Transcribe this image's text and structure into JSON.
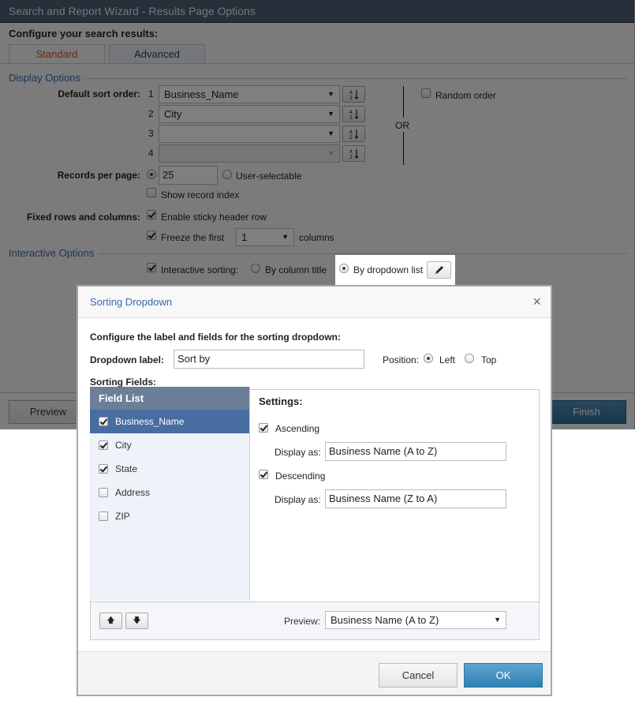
{
  "window": {
    "title": "Search and Report Wizard - Results Page Options"
  },
  "heading": "Configure your search results:",
  "tabs": [
    {
      "label": "Standard",
      "active": true
    },
    {
      "label": "Advanced",
      "active": false
    }
  ],
  "display_options": {
    "section_title": "Display Options",
    "sort_order_label": "Default sort order:",
    "sort_rows": [
      {
        "num": "1",
        "value": "Business_Name",
        "disabled": false
      },
      {
        "num": "2",
        "value": "City",
        "disabled": false
      },
      {
        "num": "3",
        "value": "",
        "disabled": false
      },
      {
        "num": "4",
        "value": "",
        "disabled": true
      }
    ],
    "or_label": "OR",
    "random_order": {
      "label": "Random order",
      "checked": false
    },
    "records_label": "Records per page:",
    "records_value": "25",
    "records_fixed_selected": true,
    "user_selectable": {
      "label": "User-selectable",
      "selected": false
    },
    "show_record_index": {
      "label": "Show record index",
      "checked": false
    },
    "fixed_label": "Fixed rows and columns:",
    "sticky_header": {
      "label": "Enable sticky header row",
      "checked": true
    },
    "freeze": {
      "label": "Freeze the first",
      "checked": true,
      "value": "1",
      "suffix": "columns"
    }
  },
  "interactive_options": {
    "section_title": "Interactive Options",
    "interactive_sorting": {
      "label": "Interactive sorting:",
      "checked": true
    },
    "by_column_title": {
      "label": "By column title",
      "selected": false
    },
    "by_dropdown_list": {
      "label": "By dropdown list",
      "selected": true
    }
  },
  "wizard_footer": {
    "preview_label": "Preview",
    "finish_label": "Finish"
  },
  "dialog": {
    "title": "Sorting Dropdown",
    "close_icon": "×",
    "intro": "Configure the label and fields for the sorting dropdown:",
    "dropdown_label_caption": "Dropdown label:",
    "dropdown_label_value": "Sort by",
    "position_caption": "Position:",
    "position_options": [
      {
        "label": "Left",
        "selected": true
      },
      {
        "label": "Top",
        "selected": false
      }
    ],
    "sorting_fields_caption": "Sorting Fields:",
    "field_list_header": "Field List",
    "fields": [
      {
        "name": "Business_Name",
        "checked": true,
        "selected": true
      },
      {
        "name": "City",
        "checked": true,
        "selected": false
      },
      {
        "name": "State",
        "checked": true,
        "selected": false
      },
      {
        "name": "Address",
        "checked": false,
        "selected": false
      },
      {
        "name": "ZIP",
        "checked": false,
        "selected": false
      }
    ],
    "settings": {
      "title": "Settings:",
      "ascending": {
        "label": "Ascending",
        "checked": true,
        "display_caption": "Display as:",
        "display_value": "Business Name (A to Z)"
      },
      "descending": {
        "label": "Descending",
        "checked": true,
        "display_caption": "Display as:",
        "display_value": "Business Name (Z to A)"
      }
    },
    "move_up_icon": "🡅",
    "move_down_icon": "🡇",
    "preview_caption": "Preview:",
    "preview_value": "Business Name (A to Z)",
    "cancel_label": "Cancel",
    "ok_label": "OK"
  }
}
